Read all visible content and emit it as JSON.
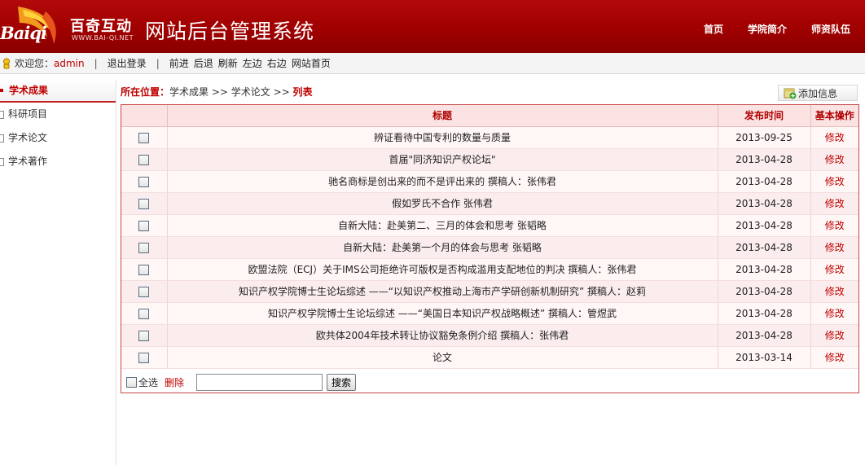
{
  "header": {
    "logo_en": "Baiqi",
    "logo_cn": "百奇互动",
    "logo_url": "WWW.BAI-QI.NET",
    "system_title": "网站后台管理系统",
    "nav": [
      "首页",
      "学院简介",
      "师资队伍"
    ]
  },
  "toolbar": {
    "welcome": "欢迎您：",
    "username": "admin",
    "logout": "退出登录",
    "links": [
      "前进",
      "后退",
      "刷新",
      "左边",
      "右边",
      "网站首页"
    ]
  },
  "sidebar": {
    "title": "学术成果",
    "items": [
      {
        "label": "科研项目"
      },
      {
        "label": "学术论文"
      },
      {
        "label": "学术著作"
      }
    ]
  },
  "breadcrumb": {
    "label": "所在位置：",
    "path": "学术成果 >> 学术论文 >> ",
    "current": "列表"
  },
  "add_button": {
    "label": "添加信息"
  },
  "table": {
    "headers": {
      "title": "标题",
      "date": "发布时间",
      "action": "基本操作"
    },
    "edit_label": "修改",
    "rows": [
      {
        "title": "辨证看待中国专利的数量与质量",
        "date": "2013-09-25"
      },
      {
        "title": "首届\"同济知识产权论坛\"",
        "date": "2013-04-28"
      },
      {
        "title": "驰名商标是创出来的而不是评出来的 撰稿人：张伟君",
        "date": "2013-04-28"
      },
      {
        "title": "假如罗氏不合作 张伟君",
        "date": "2013-04-28"
      },
      {
        "title": "自新大陆：赴美第二、三月的体会和思考 张韬略",
        "date": "2013-04-28"
      },
      {
        "title": "自新大陆：赴美第一个月的体会与思考 张韬略",
        "date": "2013-04-28"
      },
      {
        "title": "欧盟法院（ECJ）关于IMS公司拒绝许可版权是否构成滥用支配地位的判决 撰稿人：张伟君",
        "date": "2013-04-28"
      },
      {
        "title": "知识产权学院博士生论坛综述 ——“以知识产权推动上海市产学研创新机制研究” 撰稿人：赵莉",
        "date": "2013-04-28"
      },
      {
        "title": "知识产权学院博士生论坛综述 ——“美国日本知识产权战略概述” 撰稿人：管煜武",
        "date": "2013-04-28"
      },
      {
        "title": "欧共体2004年技术转让协议豁免条例介绍 撰稿人：张伟君",
        "date": "2013-04-28"
      },
      {
        "title": "论文",
        "date": "2013-03-14"
      }
    ]
  },
  "bottom": {
    "select_all": "全选",
    "delete": "删除",
    "search_button": "搜索",
    "search_value": ""
  }
}
